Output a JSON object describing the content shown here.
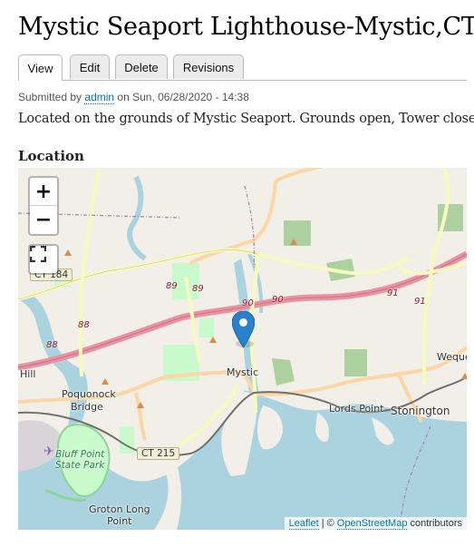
{
  "page": {
    "title": "Mystic Seaport Lighthouse-Mystic,CT",
    "tabs": [
      {
        "label": "View",
        "active": true
      },
      {
        "label": "Edit",
        "active": false
      },
      {
        "label": "Delete",
        "active": false
      },
      {
        "label": "Revisions",
        "active": false
      }
    ],
    "submitted": {
      "prefix": "Submitted by",
      "author": "admin",
      "suffix": "on Sun, 06/28/2020 - 14:38"
    },
    "body": "Located on the grounds of Mystic Seaport. Grounds open, Tower closed",
    "location_label": "Location"
  },
  "map": {
    "controls": {
      "zoom_in": "+",
      "zoom_out": "−",
      "fullscreen_icon": "fullscreen-icon"
    },
    "marker_icon": "map-pin-icon",
    "place_labels": {
      "mystic": "Mystic",
      "poquonock": "Poquonock",
      "bridge": "Bridge",
      "hill": "Hill",
      "bluff_point_1": "Bluff Point",
      "bluff_point_2": "State Park",
      "groton_long_1": "Groton Long",
      "groton_long_2": "Point",
      "lords_point": "Lords Point",
      "stonington": "Stonington",
      "weque": "Weque"
    },
    "route_shields": {
      "ct184": "CT 184",
      "ct215": "CT 215"
    },
    "highway_numbers": {
      "h88a": "88",
      "h88b": "88",
      "h89a": "89",
      "h89b": "89",
      "h90a": "90",
      "h90b": "90",
      "h91a": "91",
      "h91b": "91"
    },
    "attribution": {
      "leaflet": "Leaflet",
      "separator": "| ©",
      "osm": "OpenStreetMap",
      "contributors": "contributors"
    },
    "colors": {
      "land": "#f2efe9",
      "water": "#aad3df",
      "park": "#c8facc",
      "wood": "#add19e",
      "motorway": "#e892a2",
      "primary": "#fcd6a4",
      "secondary": "#f7fabf",
      "marker": "#2a81cb"
    }
  }
}
